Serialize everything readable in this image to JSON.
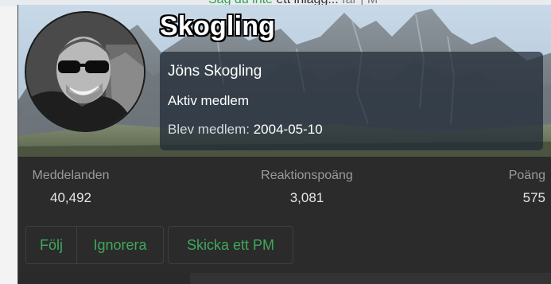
{
  "page": {
    "behind_link": "Såg du inte",
    "behind_text": " ett inlägg... ",
    "behind_end": "får | M"
  },
  "member": {
    "username": "Skogling",
    "full_name": "Jöns Skogling",
    "title": "Aktiv medlem",
    "joined_label": "Blev medlem:",
    "joined_value": "2004-05-10"
  },
  "stats": [
    {
      "label": "Meddelanden",
      "value": "40,492"
    },
    {
      "label": "Reaktionspoäng",
      "value": "3,081"
    },
    {
      "label": "Poäng",
      "value": "575"
    }
  ],
  "actions": {
    "follow": "Följ",
    "ignore": "Ignorera",
    "pm": "Skicka ett PM"
  },
  "colors": {
    "accent": "#3fa85b",
    "card_bg": "#2c2c2c",
    "info_box_bg": "rgba(30,40,52,0.72)"
  }
}
